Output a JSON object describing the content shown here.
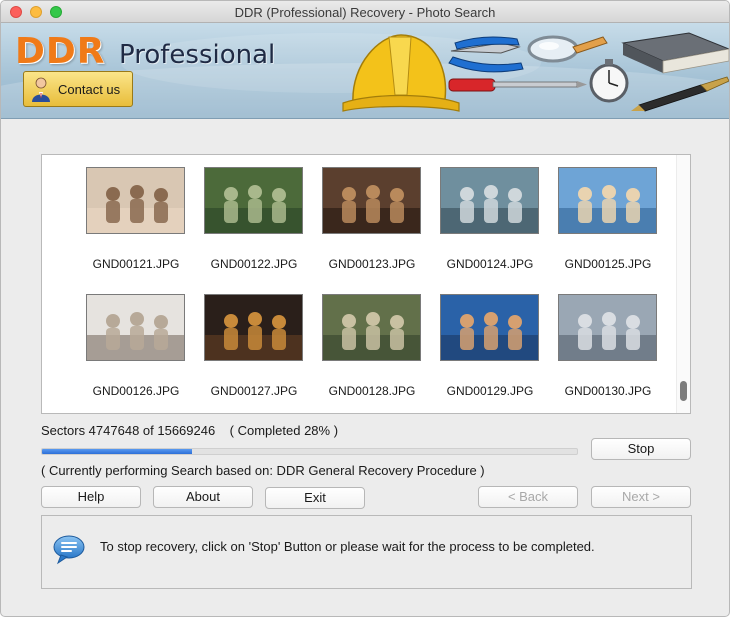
{
  "window": {
    "title": "DDR (Professional) Recovery - Photo Search"
  },
  "banner": {
    "brand": "DDR",
    "edition": "Professional",
    "contact_label": "Contact us",
    "brand_color": "#f07a18",
    "icons": [
      "hard-hat-icon",
      "pliers-icon",
      "screwdriver-icon",
      "magnifier-icon",
      "stopwatch-icon",
      "book-icon",
      "pen-icon"
    ]
  },
  "results": {
    "files": [
      {
        "name": "GND00121.JPG"
      },
      {
        "name": "GND00122.JPG"
      },
      {
        "name": "GND00123.JPG"
      },
      {
        "name": "GND00124.JPG"
      },
      {
        "name": "GND00125.JPG"
      },
      {
        "name": "GND00126.JPG"
      },
      {
        "name": "GND00127.JPG"
      },
      {
        "name": "GND00128.JPG"
      },
      {
        "name": "GND00129.JPG"
      },
      {
        "name": "GND00130.JPG"
      }
    ]
  },
  "status": {
    "sectors_text": "Sectors 4747648 of 15669246",
    "completed_text": "( Completed 28% )",
    "progress": 0.28,
    "procedure_text": "( Currently performing Search based on: DDR General Recovery Procedure )",
    "accent_color": "#2c6fd8"
  },
  "buttons": {
    "stop": "Stop",
    "help": "Help",
    "about": "About",
    "exit": "Exit",
    "back": "< Back",
    "next": "Next >"
  },
  "info": {
    "message": "To stop recovery, click on 'Stop' Button or please wait for the process to be completed."
  }
}
